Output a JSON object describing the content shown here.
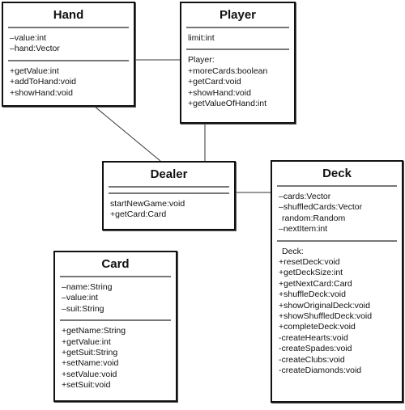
{
  "diagram": {
    "type": "UML class diagram",
    "classes": {
      "hand": {
        "name": "Hand",
        "attributes": [
          "–value:int",
          "–hand:Vector"
        ],
        "operations": [
          "+getValue:int",
          "+addToHand:void",
          "+showHand:void"
        ]
      },
      "player": {
        "name": "Player",
        "attributes": [
          "limit:int"
        ],
        "operations": [
          "Player:",
          "+moreCards:boolean",
          "+getCard:void",
          "+showHand:void",
          "+getValueOfHand:int"
        ]
      },
      "dealer": {
        "name": "Dealer",
        "attributes": [],
        "operations": [
          "startNewGame:void",
          "+getCard:Card"
        ]
      },
      "deck": {
        "name": "Deck",
        "attributes": [
          "–cards:Vector",
          "–shuffledCards:Vector",
          "random:Random",
          "–nextItem:int"
        ],
        "operations": [
          "Deck:",
          "+resetDeck:void",
          "+getDeckSize:int",
          "+getNextCard:Card",
          "+shuffleDeck:void",
          "+showOriginalDeck:void",
          "+showShuffledDeck:void",
          "+completeDeck:void",
          "-createHearts:void",
          "-createSpades:void",
          "-createClubs:void",
          "-createDiamonds:void"
        ]
      },
      "card": {
        "name": "Card",
        "attributes": [
          "–name:String",
          "–value:int",
          "–suit:String"
        ],
        "operations": [
          "+getName:String",
          "+getValue:int",
          "+getSuit:String",
          "+setName:void",
          "+setValue:void",
          "+setSuit:void"
        ]
      }
    },
    "associations": [
      {
        "from": "Hand",
        "to": "Player"
      },
      {
        "from": "Hand",
        "to": "Dealer"
      },
      {
        "from": "Player",
        "to": "Dealer"
      },
      {
        "from": "Dealer",
        "to": "Deck"
      }
    ]
  }
}
